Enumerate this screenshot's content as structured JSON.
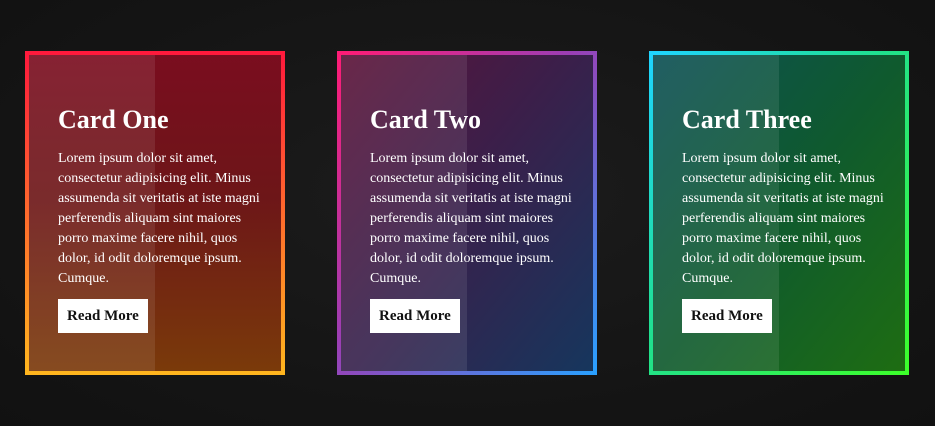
{
  "cards": [
    {
      "title": "Card One",
      "text": "Lorem ipsum dolor sit amet, consectetur adipisicing elit. Minus assumenda sit veritatis at iste magni perferendis aliquam sint maiores porro maxime facere nihil, quos dolor, id odit doloremque ipsum. Cumque.",
      "button_label": "Read More"
    },
    {
      "title": "Card Two",
      "text": "Lorem ipsum dolor sit amet, consectetur adipisicing elit. Minus assumenda sit veritatis at iste magni perferendis aliquam sint maiores porro maxime facere nihil, quos dolor, id odit doloremque ipsum. Cumque.",
      "button_label": "Read More"
    },
    {
      "title": "Card Three",
      "text": "Lorem ipsum dolor sit amet, consectetur adipisicing elit. Minus assumenda sit veritatis at iste magni perferendis aliquam sint maiores porro maxime facere nihil, quos dolor, id odit doloremque ipsum. Cumque.",
      "button_label": "Read More"
    }
  ],
  "colors": {
    "page_background": "#171717",
    "card_one_border": [
      "#ff1a3c",
      "#ffb51e"
    ],
    "card_two_border": [
      "#ff1c76",
      "#2aa0ff"
    ],
    "card_three_border": [
      "#1fd4ff",
      "#3cff2a"
    ],
    "button_background": "#ffffff",
    "button_text": "#111111"
  }
}
